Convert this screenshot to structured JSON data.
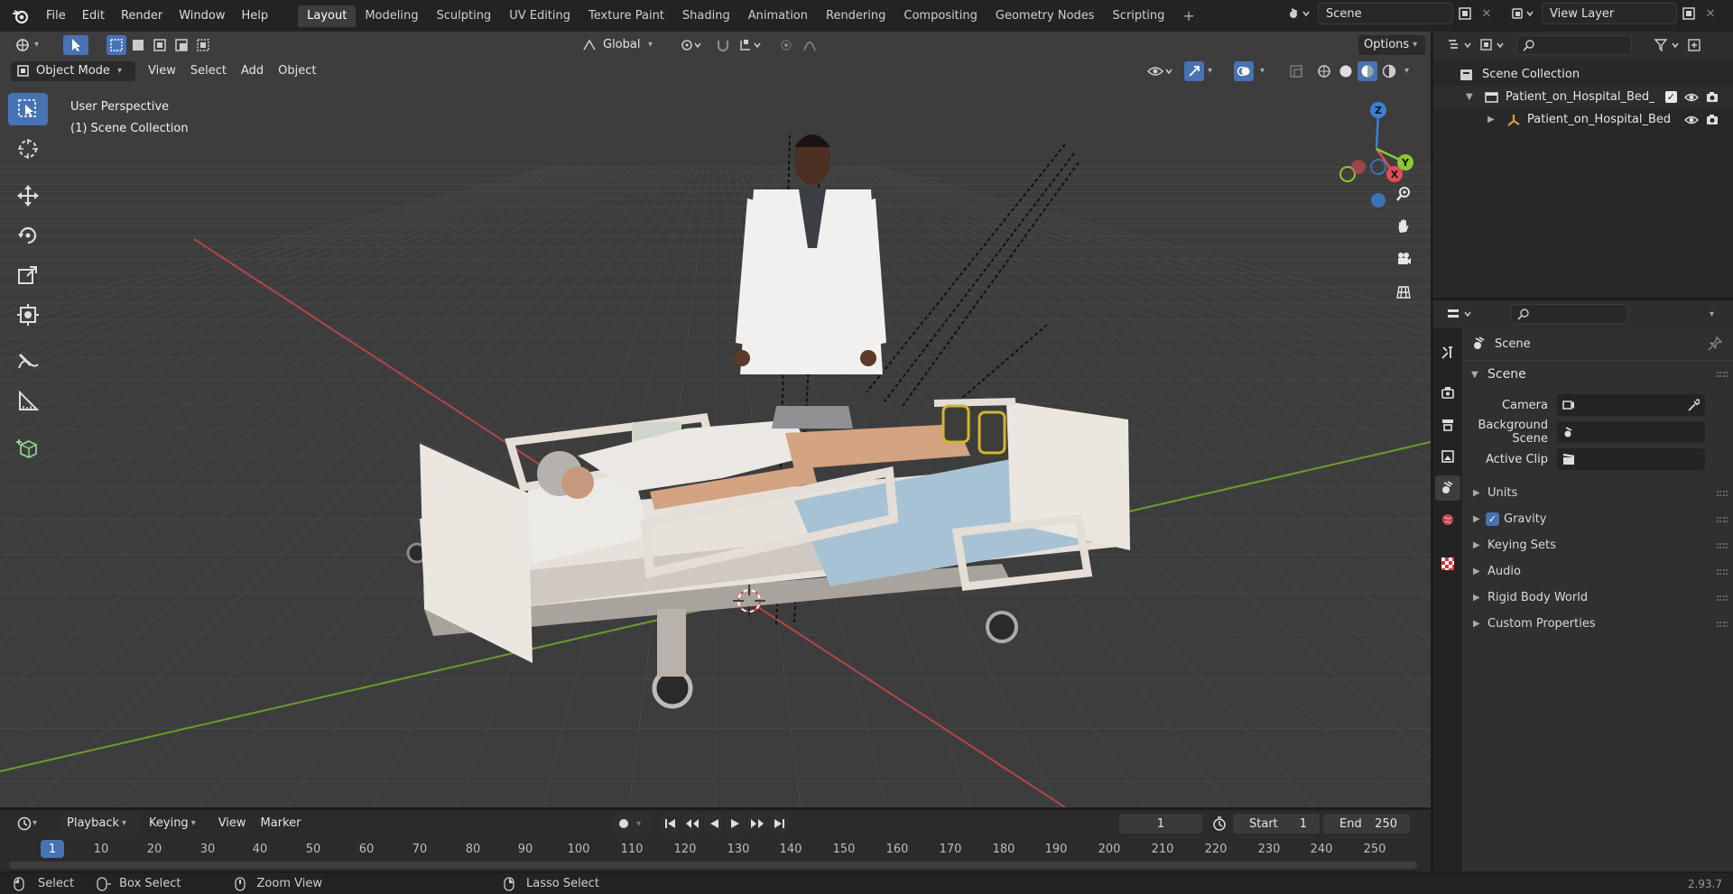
{
  "topbar": {
    "menus": [
      "File",
      "Edit",
      "Render",
      "Window",
      "Help"
    ],
    "workspaces": [
      "Layout",
      "Modeling",
      "Sculpting",
      "UV Editing",
      "Texture Paint",
      "Shading",
      "Animation",
      "Rendering",
      "Compositing",
      "Geometry Nodes",
      "Scripting"
    ],
    "active_workspace": "Layout",
    "scene_name": "Scene",
    "view_layer": "View Layer"
  },
  "viewport": {
    "transform_orientation": "Global",
    "options_label": "Options",
    "mode": "Object Mode",
    "menus": [
      "View",
      "Select",
      "Add",
      "Object"
    ],
    "info_line1": "User Perspective",
    "info_line2": "(1) Scene Collection",
    "gizmo_axes": {
      "x": "X",
      "y": "Y",
      "z": "Z"
    },
    "colors": {
      "x_axis": "#e34b55",
      "y_axis": "#8cc733",
      "z_axis": "#3c7fd6",
      "background": "#3d3d3d",
      "grid": "#4a4a4a"
    }
  },
  "outliner": {
    "root": "Scene Collection",
    "collection": "Patient_on_Hospital_Bed_Anc",
    "object": "Patient_on_Hospital_Bed"
  },
  "properties": {
    "context_label": "Scene",
    "panel_title": "Scene",
    "fields": [
      {
        "label": "Camera",
        "value": ""
      },
      {
        "label": "Background Scene",
        "value": ""
      },
      {
        "label": "Active Clip",
        "value": ""
      }
    ],
    "sections": [
      {
        "label": "Units",
        "checkbox": false
      },
      {
        "label": "Gravity",
        "checkbox": true,
        "checked": true
      },
      {
        "label": "Keying Sets",
        "checkbox": false
      },
      {
        "label": "Audio",
        "checkbox": false
      },
      {
        "label": "Rigid Body World",
        "checkbox": false
      },
      {
        "label": "Custom Properties",
        "checkbox": false
      }
    ]
  },
  "timeline": {
    "menus": [
      "Playback",
      "Keying",
      "View",
      "Marker"
    ],
    "current_frame": "1",
    "start_label": "Start",
    "start_value": "1",
    "end_label": "End",
    "end_value": "250",
    "ruler": [
      "1",
      "10",
      "20",
      "30",
      "40",
      "50",
      "60",
      "70",
      "80",
      "90",
      "100",
      "110",
      "120",
      "130",
      "140",
      "150",
      "160",
      "170",
      "180",
      "190",
      "200",
      "210",
      "220",
      "230",
      "240",
      "250"
    ]
  },
  "statusbar": {
    "select": "Select",
    "box_select": "Box Select",
    "zoom_view": "Zoom View",
    "lasso_select": "Lasso Select",
    "version": "2.93.7"
  }
}
